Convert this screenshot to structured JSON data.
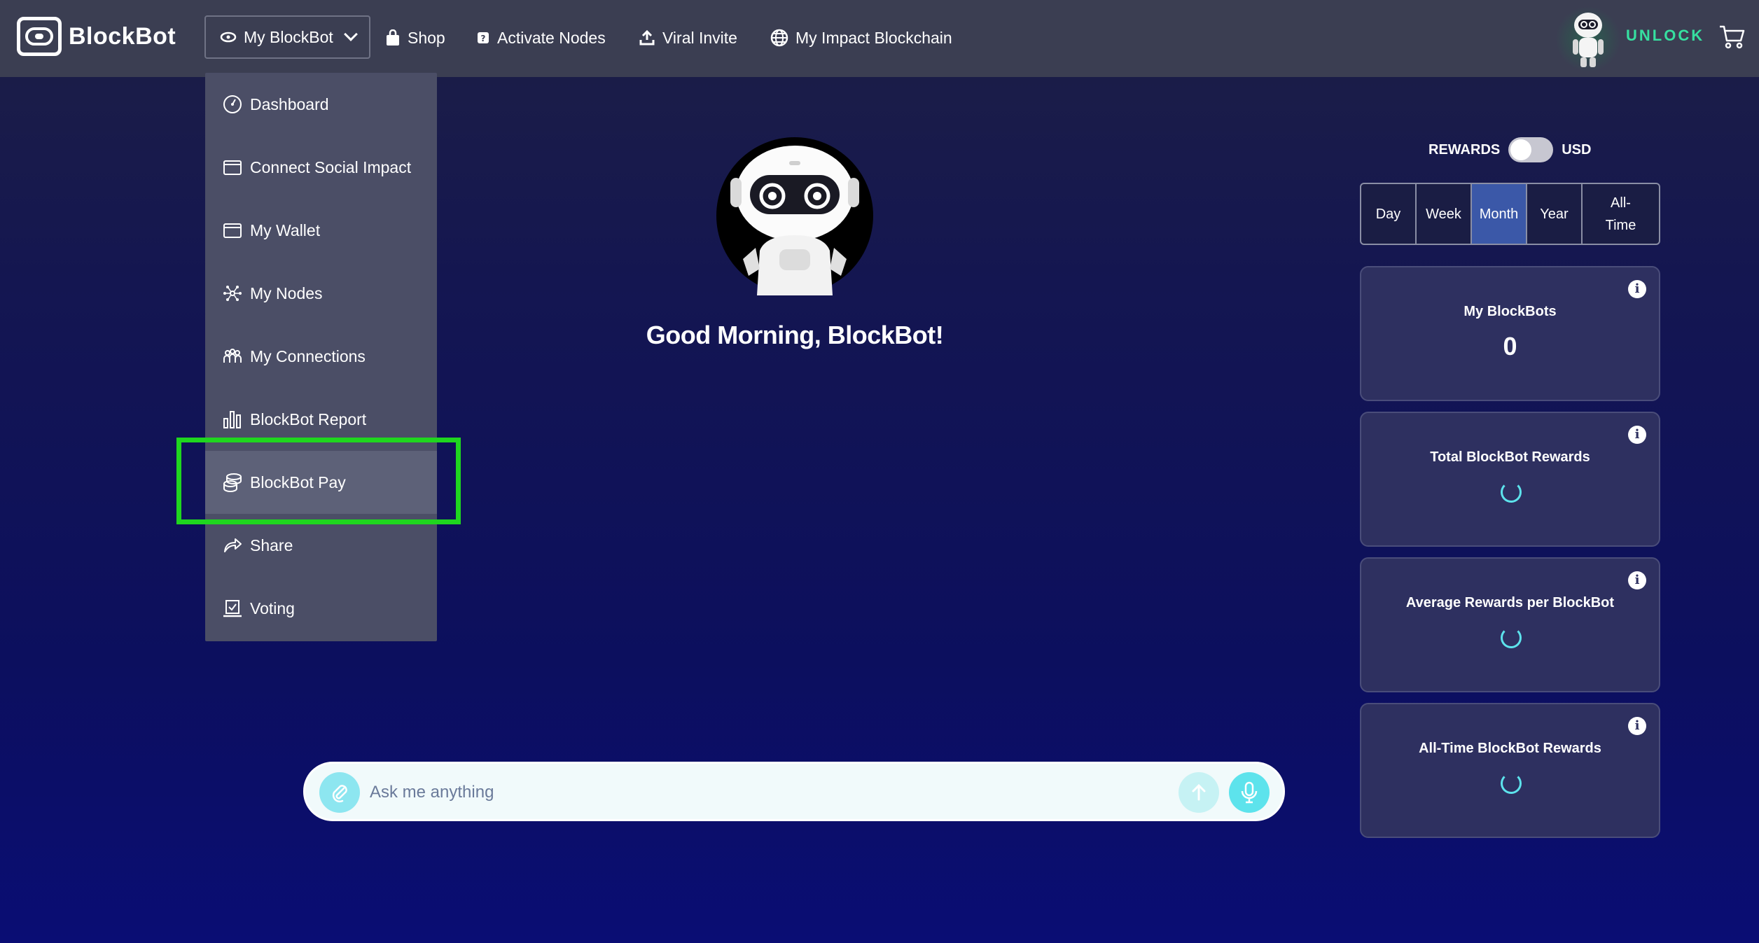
{
  "brand": {
    "name": "BlockBot"
  },
  "nav": {
    "my_blockbot": "My BlockBot",
    "shop": "Shop",
    "activate_nodes": "Activate Nodes",
    "viral_invite": "Viral Invite",
    "my_impact_blockchain": "My Impact Blockchain",
    "unlock": "UNLOCK"
  },
  "dropdown": {
    "items": [
      {
        "label": "Dashboard",
        "icon": "dashboard-icon"
      },
      {
        "label": "Connect Social Impact",
        "icon": "wallet-icon"
      },
      {
        "label": "My Wallet",
        "icon": "wallet-icon"
      },
      {
        "label": "My Nodes",
        "icon": "nodes-icon"
      },
      {
        "label": "My Connections",
        "icon": "people-icon"
      },
      {
        "label": "BlockBot Report",
        "icon": "bar-chart-icon"
      },
      {
        "label": "BlockBot Pay",
        "icon": "coins-icon",
        "active": true
      },
      {
        "label": "Share",
        "icon": "share-icon"
      },
      {
        "label": "Voting",
        "icon": "voting-icon"
      }
    ]
  },
  "main": {
    "greeting": "Good Morning, BlockBot!",
    "chat": {
      "placeholder": "Ask me anything"
    }
  },
  "rewards": {
    "toggle_left": "REWARDS",
    "toggle_right": "USD",
    "periods": [
      "Day",
      "Week",
      "Month",
      "Year",
      "All-Time"
    ],
    "active_period": "Month",
    "cards": [
      {
        "title": "My BlockBots",
        "value": "0"
      },
      {
        "title": "Total BlockBot Rewards",
        "value": null
      },
      {
        "title": "Average Rewards per BlockBot",
        "value": null
      },
      {
        "title": "All-Time BlockBot Rewards",
        "value": null
      }
    ]
  },
  "colors": {
    "topbar": "#3b3e52",
    "dropdown": "#4b4e66",
    "highlight": "#1fd61f",
    "accent": "#5de3ec",
    "unlock": "#36e0a0",
    "active_period": "#3b58a8"
  }
}
